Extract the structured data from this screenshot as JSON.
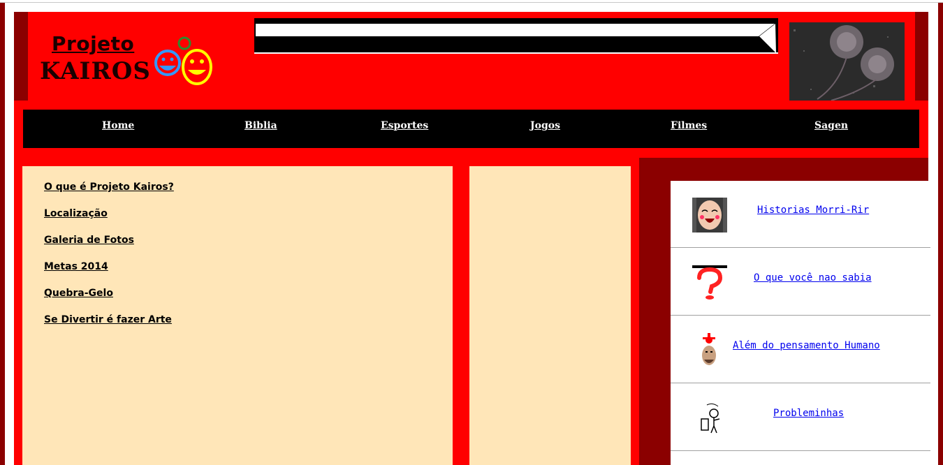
{
  "logo": {
    "line1": "Projeto",
    "line2": "KAIROS"
  },
  "nav": {
    "items": [
      {
        "label": "Home"
      },
      {
        "label": "Biblia"
      },
      {
        "label": "Esportes"
      },
      {
        "label": "Jogos"
      },
      {
        "label": "Filmes"
      },
      {
        "label": "Sagen"
      }
    ]
  },
  "sidebar": {
    "links": [
      {
        "label": "O que é Projeto Kairos?"
      },
      {
        "label": "Localização"
      },
      {
        "label": "Galeria de Fotos"
      },
      {
        "label": "Metas 2014"
      },
      {
        "label": "Quebra-Gelo"
      },
      {
        "label": "Se Divertir é fazer Arte"
      }
    ]
  },
  "panel": {
    "items": [
      {
        "label": "Historias Morri-Rir",
        "icon": "laughing-face-icon"
      },
      {
        "label": "O que você nao sabia",
        "icon": "question-mark-icon"
      },
      {
        "label": "Além do pensamento Humano",
        "icon": "exploding-head-icon"
      },
      {
        "label": "Probleminhas",
        "icon": "sketch-figure-icon"
      }
    ]
  },
  "colors": {
    "header_red": "#ff0000",
    "dark_red": "#8b0000",
    "nav_black": "#000000",
    "content_beige": "#ffe6b8",
    "link_blue": "#0000ee"
  }
}
